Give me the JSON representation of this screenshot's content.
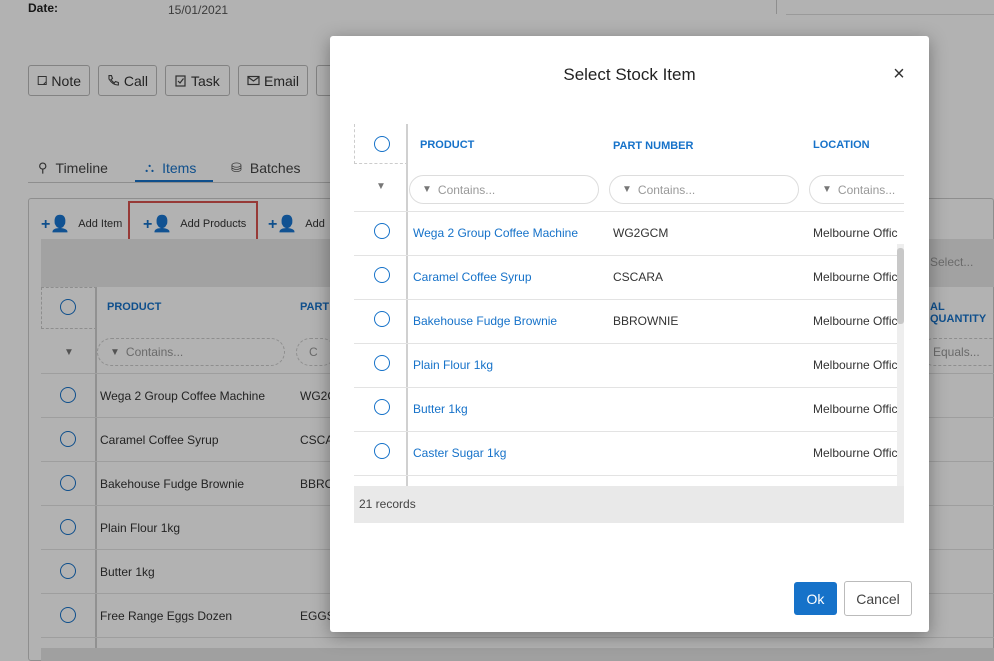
{
  "page": {
    "date_label": "Date:",
    "date_value": "15/01/2021",
    "actions": [
      {
        "label": "Note",
        "icon": "note-icon"
      },
      {
        "label": "Call",
        "icon": "phone-icon"
      },
      {
        "label": "Task",
        "icon": "task-icon"
      },
      {
        "label": "Email",
        "icon": "email-icon"
      }
    ],
    "tabs": [
      {
        "label": "Timeline",
        "icon": "timeline-icon",
        "active": false
      },
      {
        "label": "Items",
        "icon": "hierarchy-icon",
        "active": true
      },
      {
        "label": "Batches",
        "icon": "batches-icon",
        "active": false
      }
    ],
    "toolbar": {
      "add_item": "Add Item",
      "add_products": "Add Products",
      "add_third": "Add"
    },
    "grid": {
      "select_placeholder": "Select...",
      "col_product": "PRODUCT",
      "col_part": "PART",
      "col_qty": "AL QUANTITY",
      "filter_contains": "Contains...",
      "filter_contains_short": "C",
      "filter_equals": "Equals...",
      "rows": [
        {
          "product": "Wega 2 Group Coffee Machine",
          "part": "WG2C"
        },
        {
          "product": "Caramel Coffee Syrup",
          "part": "CSCA"
        },
        {
          "product": "Bakehouse Fudge Brownie",
          "part": "BBRO"
        },
        {
          "product": "Plain Flour 1kg",
          "part": ""
        },
        {
          "product": "Butter 1kg",
          "part": ""
        },
        {
          "product": "Free Range Eggs Dozen",
          "part": "EGGS"
        }
      ]
    }
  },
  "modal": {
    "title": "Select Stock Item",
    "close": "×",
    "columns": {
      "product": "PRODUCT",
      "part_number": "PART NUMBER",
      "location": "LOCATION"
    },
    "filter_placeholder": "Contains...",
    "rows": [
      {
        "product": "Wega 2 Group Coffee Machine",
        "part_number": "WG2GCM",
        "location": "Melbourne Offic"
      },
      {
        "product": "Caramel Coffee Syrup",
        "part_number": "CSCARA",
        "location": "Melbourne Offic"
      },
      {
        "product": "Bakehouse Fudge Brownie",
        "part_number": "BBROWNIE",
        "location": "Melbourne Offic"
      },
      {
        "product": "Plain Flour 1kg",
        "part_number": "",
        "location": "Melbourne Offic"
      },
      {
        "product": "Butter 1kg",
        "part_number": "",
        "location": "Melbourne Offic"
      },
      {
        "product": "Caster Sugar 1kg",
        "part_number": "",
        "location": "Melbourne Offic"
      }
    ],
    "records": "21 records",
    "ok_label": "Ok",
    "cancel_label": "Cancel"
  },
  "colors": {
    "accent": "#1672c9",
    "highlight_border": "#d9534f",
    "overlay": "rgba(0,0,0,0.30)"
  }
}
